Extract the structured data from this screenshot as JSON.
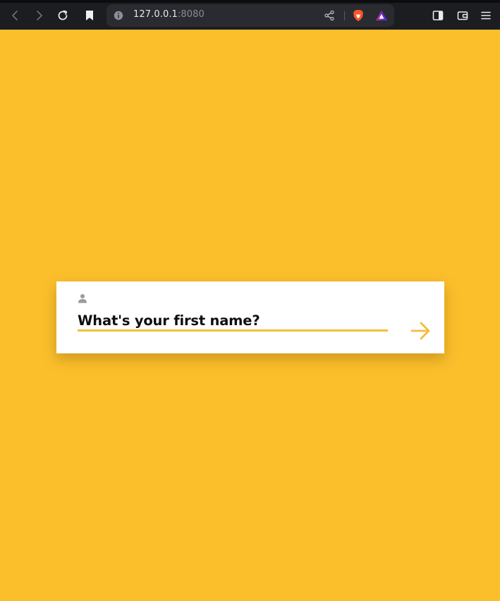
{
  "browser": {
    "url_host": "127.0.0.1",
    "url_port": ":8080",
    "toolbar_icons": {
      "back": "chevron-left-icon",
      "forward": "chevron-right-icon",
      "reload": "reload-icon",
      "bookmark": "bookmark-icon",
      "site_info": "info-icon",
      "share": "share-icon",
      "brave_shields": "brave-lion-icon",
      "brave_rewards": "rewards-triangle-icon",
      "sidebar": "sidebar-icon",
      "wallet": "wallet-icon",
      "menu": "hamburger-menu-icon"
    }
  },
  "form": {
    "question": "What's your first name?",
    "input_value": "",
    "field_icon": "person-icon",
    "next_icon": "arrow-right-icon"
  },
  "colors": {
    "page_background": "#fbbf2c",
    "accent": "#f2bf3c",
    "toolbar": "#1c1d21"
  }
}
